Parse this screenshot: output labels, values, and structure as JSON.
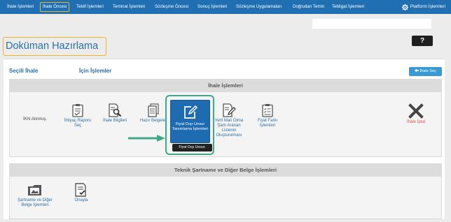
{
  "nav": {
    "items": [
      {
        "label": "İhale İşlemleri"
      },
      {
        "label": "İhale Öncesi"
      },
      {
        "label": "Teklif İşlemleri"
      },
      {
        "label": "Teminat İşlemleri"
      },
      {
        "label": "Sözleşme Öncesi"
      },
      {
        "label": "Sonuç İşlemleri"
      },
      {
        "label": "Sözleşme Uygulamaları"
      },
      {
        "label": "Doğrudan Temin"
      },
      {
        "label": "Tebligat İşlemleri"
      }
    ],
    "platform_label": "Platform İşlemleri"
  },
  "page": {
    "title": "Doküman Hazırlama",
    "help_label": "?",
    "selected_tender_label": "Seçili İhale",
    "actions_for_label": "İçin İşlemler",
    "select_tender_button": "İhale Seç"
  },
  "ihale_section": {
    "title": "İhale İşlemleri",
    "ikn_text": "İKN Alınmış.",
    "tiles": [
      {
        "label": "İhtiyaç Raporu Seç"
      },
      {
        "label": "İhale Bilgileri"
      },
      {
        "label": "Hazır Belgeler"
      },
      {
        "label": "Fiyat Dışı Unsur Tanımlama İşlemleri"
      },
      {
        "label": "Yerli Malı Olma Şartı Aranan Listenin Oluşturulması"
      },
      {
        "label": "Fiyat Farkı İşlemleri"
      },
      {
        "label": "İhale İptal"
      }
    ],
    "tooltip": "Fiyat Dışı Unsur."
  },
  "teknik_section": {
    "title": "Teknik Şartname ve Diğer Belge İşlemleri",
    "tiles": [
      {
        "label": "Şartname ve Diğer Belge İşlemleri"
      },
      {
        "label": "Onayla"
      }
    ]
  },
  "colors": {
    "nav_bg": "#1f6fb2",
    "accent_highlight": "#f0b429",
    "tile_active": "#1e6bb1",
    "annotation_green": "#3fa88b",
    "cancel_red": "#d9534f"
  },
  "icons": [
    "gear-icon",
    "clipboard-check-icon",
    "document-search-icon",
    "documents-icon",
    "edit-icon",
    "document-edit-icon",
    "checklist-icon",
    "close-icon",
    "folder-image-icon",
    "approve-icon",
    "back-arrow-icon",
    "pointer-arrow-icon"
  ]
}
